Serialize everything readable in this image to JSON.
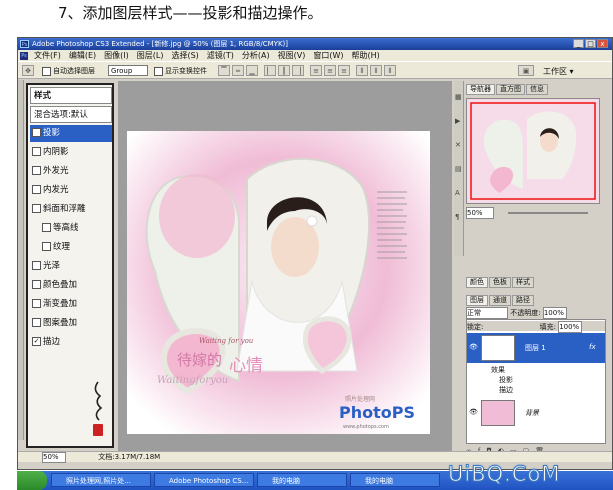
{
  "caption": "7、添加图层样式——投影和描边操作。",
  "titlebar": {
    "title": "Adobe Photoshop CS3 Extended - [新修.jpg @ 50% (图层 1, RGB/8/CMYK)]",
    "ps_logo": "Ps",
    "minimize": "_",
    "restore": "□",
    "close": "x"
  },
  "menubar": {
    "ps_logo": "Ps",
    "items": [
      "文件(F)",
      "编辑(E)",
      "图像(I)",
      "图层(L)",
      "选择(S)",
      "滤镜(T)",
      "分析(A)",
      "视图(V)",
      "窗口(W)",
      "帮助(H)"
    ]
  },
  "options": {
    "auto_select": "自动选择图层",
    "group_value": "Group",
    "show_transform": "显示变换控件",
    "workspace": "工作区 ▾"
  },
  "style_dialog": {
    "title": "样式",
    "blend_options": "混合选项:默认",
    "items": [
      {
        "label": "投影",
        "checked": true,
        "selected": true
      },
      {
        "label": "内阴影",
        "checked": false,
        "selected": false
      },
      {
        "label": "外发光",
        "checked": false,
        "selected": false
      },
      {
        "label": "内发光",
        "checked": false,
        "selected": false
      },
      {
        "label": "斜面和浮雕",
        "checked": false,
        "selected": false
      },
      {
        "label": "等高线",
        "checked": false,
        "selected": false,
        "sub": true
      },
      {
        "label": "纹理",
        "checked": false,
        "selected": false,
        "sub": true
      },
      {
        "label": "光泽",
        "checked": false,
        "selected": false
      },
      {
        "label": "颜色叠加",
        "checked": false,
        "selected": false
      },
      {
        "label": "渐变叠加",
        "checked": false,
        "selected": false
      },
      {
        "label": "图案叠加",
        "checked": false,
        "selected": false
      },
      {
        "label": "描边",
        "checked": true,
        "selected": false
      }
    ]
  },
  "document": {
    "script_small": "Waiting for you",
    "title_main": "待嫁的",
    "title_accent": "心情",
    "subtitle": "Waitingforyou",
    "brand_small": "照片处理网",
    "brand": "PhotoPS",
    "brand_url": "www.photops.com"
  },
  "panels": {
    "nav_tabs": [
      "导航器",
      "直方图",
      "信息"
    ],
    "nav_zoom": "50%",
    "color_tabs": [
      "颜色",
      "色板",
      "样式"
    ],
    "layer_tabs": [
      "图层",
      "通道",
      "路径"
    ],
    "blend_mode": "正常",
    "opacity_label": "不透明度:",
    "opacity_value": "100%",
    "lock_label": "锁定:",
    "fill_label": "填充:",
    "fill_value": "100%",
    "layer1_name": "图层 1",
    "fx_label": "fx",
    "effects_label": "效果",
    "effect1": "投影",
    "effect2": "描边",
    "background_name": "背景"
  },
  "statusbar": {
    "zoom": "50%",
    "doc_info": "文档:3.17M/7.18M"
  },
  "taskbar": {
    "tasks": [
      "照片处理网,照片处...",
      "Adobe Photoshop CS...",
      "我的电脑",
      "我的电脑"
    ]
  },
  "watermark": "UiBQ.CoM",
  "colors": {
    "pink": "#e8a9c8",
    "accent_pink": "#d27aa8",
    "brand_blue": "#2a5fc4",
    "brand_red": "#e02828"
  }
}
